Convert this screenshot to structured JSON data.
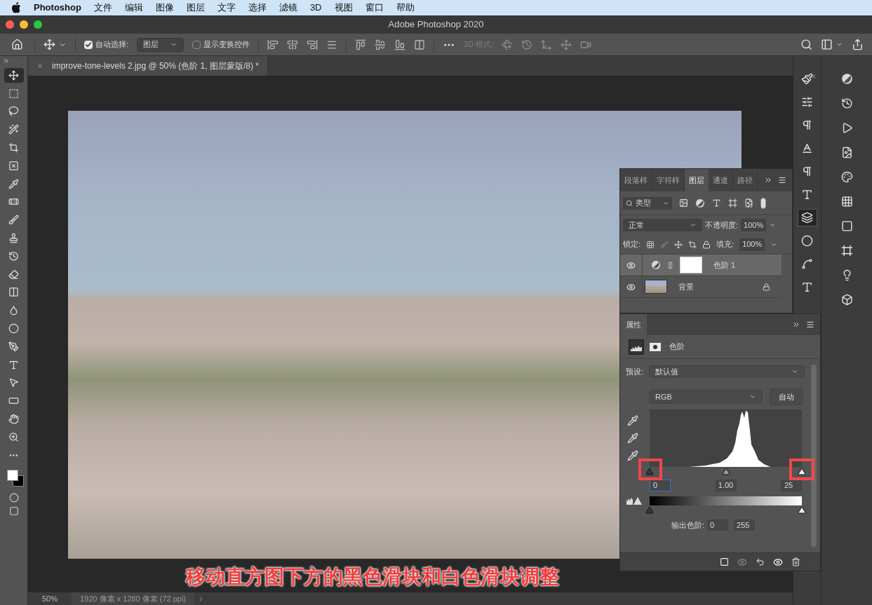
{
  "menu_bar": {
    "app": "Photoshop",
    "items": [
      "文件",
      "编辑",
      "图像",
      "图层",
      "文字",
      "选择",
      "滤镜",
      "3D",
      "视图",
      "窗口",
      "帮助"
    ]
  },
  "window": {
    "title": "Adobe Photoshop 2020"
  },
  "options_bar": {
    "auto_select": {
      "label": "自动选择:",
      "checked": true
    },
    "auto_select_target": "图层",
    "show_transform": {
      "label": "显示变换控件",
      "checked": false
    },
    "mode_3d": "3D 模式:"
  },
  "document_tab": {
    "title": "improve-tone-levels 2.jpg @ 50% (色阶 1, 图层蒙版/8) *"
  },
  "tools": [
    {
      "selected": true
    },
    {
      "selected": false
    },
    {
      "selected": false
    },
    {
      "selected": false
    },
    {
      "selected": false
    },
    {
      "selected": false
    },
    {
      "selected": false
    },
    {
      "selected": false
    },
    {
      "selected": false
    },
    {
      "selected": false
    },
    {
      "selected": false
    },
    {
      "selected": false
    },
    {
      "selected": false
    },
    {
      "selected": false
    },
    {
      "selected": false
    },
    {
      "selected": false
    },
    {
      "selected": false
    },
    {
      "selected": false
    },
    {
      "selected": false
    },
    {
      "selected": false
    },
    {
      "selected": false
    },
    {
      "selected": false
    }
  ],
  "dock_left": [
    {
      "selected": false
    },
    {
      "selected": false
    },
    {
      "selected": false
    },
    {
      "selected": false
    },
    {
      "selected": false
    },
    {
      "selected": false
    },
    {
      "selected": true
    },
    {
      "selected": false
    },
    {
      "selected": false
    },
    {
      "selected": false
    }
  ],
  "layers_panel": {
    "tabs": [
      {
        "label": "段落样",
        "selected": false
      },
      {
        "label": "字符样",
        "selected": false
      },
      {
        "label": "图层",
        "selected": true
      },
      {
        "label": "通道",
        "selected": false
      },
      {
        "label": "路径",
        "selected": false
      }
    ],
    "filter": "类型",
    "blend_mode": "正常",
    "opacity_label": "不透明度:",
    "opacity": "100%",
    "lock_label": "锁定:",
    "fill_label": "填充:",
    "fill": "100%",
    "layers": [
      {
        "name": "色阶 1",
        "kind": "adjustment",
        "visible": true,
        "locked": false,
        "selected": true
      },
      {
        "name": "背景",
        "kind": "image",
        "visible": true,
        "locked": true,
        "selected": false
      }
    ]
  },
  "properties_panel": {
    "tab": "属性",
    "title": "色阶",
    "preset_label": "预设:",
    "preset": "默认值",
    "channel": "RGB",
    "auto_button": "自动",
    "input_sliders": [
      {
        "kind": "black",
        "level": 0
      },
      {
        "kind": "gray",
        "level": 0.5
      },
      {
        "kind": "white",
        "level": 1
      }
    ],
    "input_values": [
      {
        "value": "0",
        "focused": true
      },
      {
        "value": "1.00",
        "focused": false
      },
      {
        "value": "25",
        "focused": false
      }
    ],
    "output_label": "输出色阶:",
    "output_values": [
      "0",
      "255"
    ],
    "output_sliders": [
      {
        "kind": "black",
        "level": 0
      },
      {
        "kind": "white",
        "level": 1
      }
    ]
  },
  "status_bar": {
    "zoom": "50%",
    "info": "1920 像素 x 1280 像素 (72 ppi)"
  },
  "caption": "移动直方图下方的黑色滑块和白色滑块调整"
}
